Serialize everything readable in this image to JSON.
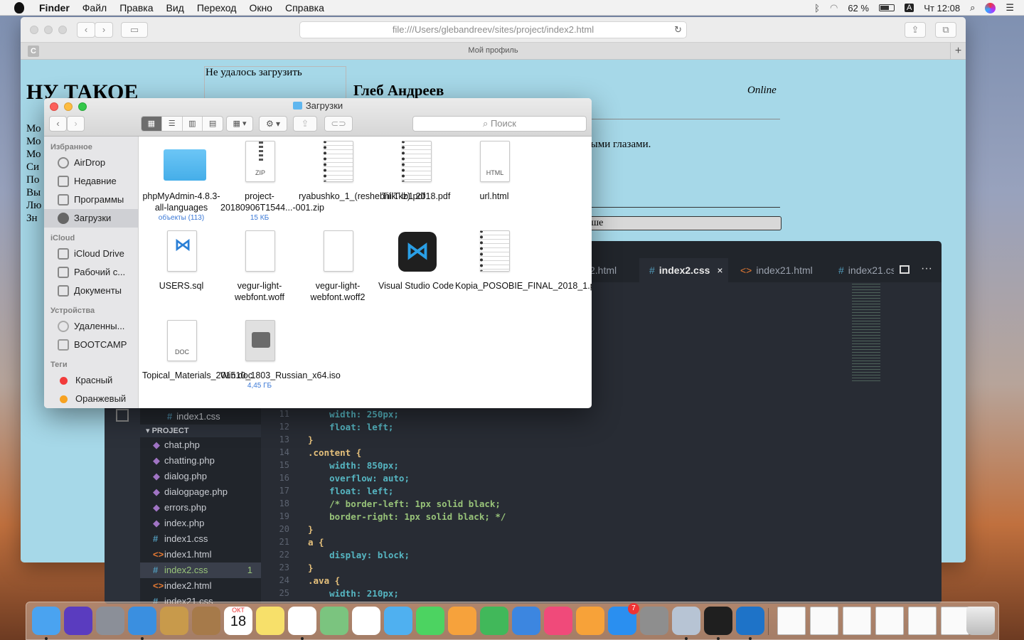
{
  "menubar": {
    "app": "Finder",
    "items": [
      "Файл",
      "Правка",
      "Вид",
      "Переход",
      "Окно",
      "Справка"
    ],
    "battery": "62 %",
    "input": "A",
    "clock": "Чт 12:08"
  },
  "safari": {
    "url": "file:///Users/glebandreev/sites/project/index2.html",
    "tab_title": "Мой профиль",
    "tab_icon": "C",
    "page": {
      "heading": "НУ ТАКОЕ",
      "failed": "Не удалось загрузить",
      "name": "Глеб Андреев",
      "status": "Online",
      "frag1": "быми глазами.",
      "frag2": "ьше",
      "left_frags": [
        "Мо",
        "Мо",
        "Мо",
        "Си",
        "По",
        "Вы",
        "Лю",
        "Зн"
      ]
    }
  },
  "editor": {
    "tabs": [
      {
        "label": "2.html",
        "icon": ""
      },
      {
        "label": "index2.css",
        "icon": "#",
        "active": true,
        "close": "×"
      },
      {
        "label": "index21.html",
        "icon": "<>"
      },
      {
        "label": "index21.cs",
        "icon": "#"
      }
    ],
    "open_file": "index1.css",
    "project_label": "PROJECT",
    "files": [
      {
        "name": "chat.php",
        "icon": "php"
      },
      {
        "name": "chatting.php",
        "icon": "php"
      },
      {
        "name": "dialog.php",
        "icon": "php"
      },
      {
        "name": "dialogpage.php",
        "icon": "php"
      },
      {
        "name": "errors.php",
        "icon": "php"
      },
      {
        "name": "index.php",
        "icon": "php"
      },
      {
        "name": "index1.css",
        "icon": "#"
      },
      {
        "name": "index1.html",
        "icon": "<>"
      },
      {
        "name": "index2.css",
        "icon": "#",
        "active": true,
        "badge": "1"
      },
      {
        "name": "index2.html",
        "icon": "<>"
      },
      {
        "name": "index21.css",
        "icon": "#"
      }
    ],
    "lines": [
      {
        "n": "11",
        "t": "    width: 250px;"
      },
      {
        "n": "12",
        "t": "    float: left;"
      },
      {
        "n": "13",
        "t": "}"
      },
      {
        "n": "14",
        "t": ".content {"
      },
      {
        "n": "15",
        "t": "    width: 850px;"
      },
      {
        "n": "16",
        "t": "    overflow: auto;"
      },
      {
        "n": "17",
        "t": "    float: left;"
      },
      {
        "n": "18",
        "t": "    /* border-left: 1px solid black;"
      },
      {
        "n": "19",
        "t": "    border-right: 1px solid black; */"
      },
      {
        "n": "20",
        "t": "}"
      },
      {
        "n": "21",
        "t": "a {"
      },
      {
        "n": "22",
        "t": "    display: block;"
      },
      {
        "n": "23",
        "t": "}"
      },
      {
        "n": "24",
        "t": ".ava {"
      },
      {
        "n": "25",
        "t": "    width: 210px;"
      }
    ]
  },
  "finder": {
    "title": "Загрузки",
    "search_placeholder": "Поиск",
    "sidebar": [
      {
        "header": "Избранное",
        "items": [
          {
            "label": "AirDrop",
            "icon": "airdrop-icon"
          },
          {
            "label": "Недавние",
            "icon": "recents-icon"
          },
          {
            "label": "Программы",
            "icon": "applications-icon"
          },
          {
            "label": "Загрузки",
            "icon": "downloads-icon",
            "selected": true
          }
        ]
      },
      {
        "header": "iCloud",
        "items": [
          {
            "label": "iCloud Drive",
            "icon": "cloud-icon"
          },
          {
            "label": "Рабочий с...",
            "icon": "desktop-icon"
          },
          {
            "label": "Документы",
            "icon": "documents-icon"
          }
        ]
      },
      {
        "header": "Устройства",
        "items": [
          {
            "label": "Удаленны...",
            "icon": "remote-disc-icon"
          },
          {
            "label": "BOOTCAMP",
            "icon": "disk-icon"
          }
        ]
      },
      {
        "header": "Теги",
        "items": [
          {
            "label": "Красный",
            "icon": "red-tag-icon",
            "color": "#f23b3b"
          },
          {
            "label": "Оранжевый",
            "icon": "orange-tag-icon",
            "color": "#f7a221"
          }
        ]
      }
    ],
    "files": [
      {
        "name": "phpMyAdmin-4.8.3-all-languages",
        "sub": "объекты (113)",
        "kind": "folder"
      },
      {
        "name": "project-20180906T1544...-001.zip",
        "sub": "15 КБ",
        "kind": "zip",
        "tag": "ZIP"
      },
      {
        "name": "ryabushko_1_(reshebnik.kz).pdf",
        "kind": "pdf"
      },
      {
        "name": "TiIIT lb1 2018.pdf",
        "kind": "pdf"
      },
      {
        "name": "url.html",
        "kind": "doc",
        "tag": "HTML"
      },
      {
        "name": "USERS.sql",
        "kind": "vscode-doc"
      },
      {
        "name": "vegur-light-webfont.woff",
        "kind": "blank"
      },
      {
        "name": "vegur-light-webfont.woff2",
        "kind": "blank"
      },
      {
        "name": "Visual Studio Code",
        "kind": "vscode-app"
      },
      {
        "name": "Kopia_POSOBIE_FINAL_2018_1.pdf",
        "kind": "pdf"
      },
      {
        "name": "Topical_Materials_2015.doc",
        "kind": "doc",
        "tag": "DOC"
      },
      {
        "name": "Win10_1803_Russian_x64.iso",
        "sub": "4,45 ГБ",
        "kind": "iso"
      }
    ]
  },
  "dock": {
    "calendar_month": "ОКТ",
    "calendar_day": "18",
    "appstore_badge": "7",
    "apps": [
      "finder-icon",
      "siri-icon",
      "launchpad-icon",
      "safari-icon",
      "mail-icon",
      "contacts-icon",
      "calendar-icon",
      "notes-icon",
      "reminders-icon",
      "maps-icon",
      "photos-icon",
      "messages-icon",
      "facetime-icon",
      "pages-icon",
      "numbers-icon",
      "keynote-icon",
      "itunes-icon",
      "ibooks-icon",
      "appstore-icon",
      "preferences-icon",
      "preview-icon",
      "terminal-icon",
      "vscode-icon"
    ]
  }
}
